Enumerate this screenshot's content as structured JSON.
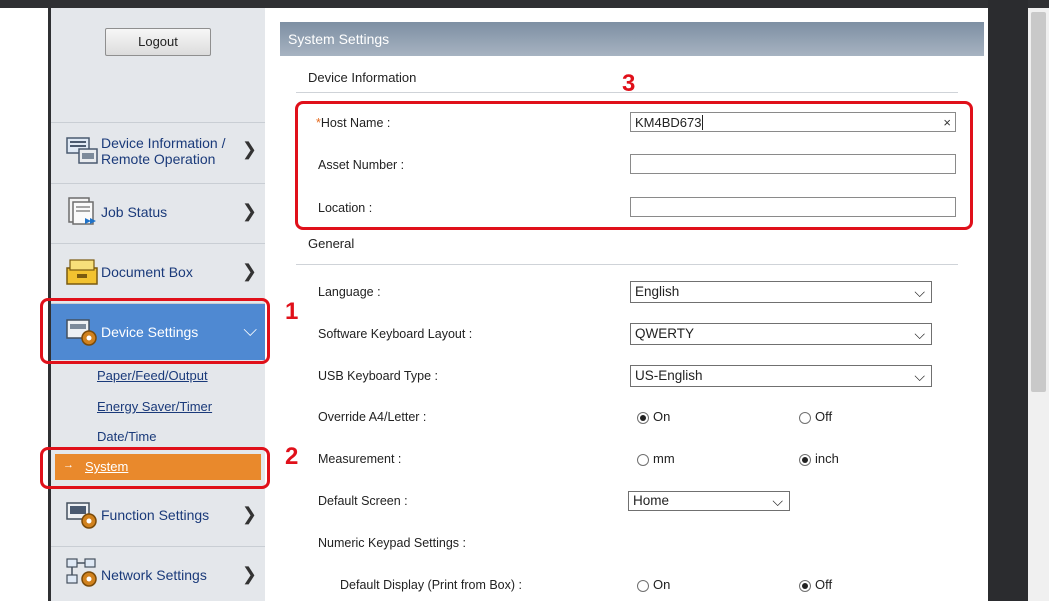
{
  "sidebar": {
    "logout_label": "Logout",
    "items": [
      {
        "label_line1": "Device Information /",
        "label_line2": "Remote Operation",
        "icon": "device-info-icon"
      },
      {
        "label": "Job Status",
        "icon": "job-status-icon"
      },
      {
        "label": "Document Box",
        "icon": "document-box-icon"
      },
      {
        "label": "Device Settings",
        "icon": "device-settings-icon",
        "active": true
      },
      {
        "label": "Function Settings",
        "icon": "function-settings-icon"
      },
      {
        "label": "Network Settings",
        "icon": "network-settings-icon"
      }
    ],
    "sublinks": [
      "Paper/Feed/Output",
      "Energy Saver/Timer",
      "Date/Time",
      "System"
    ],
    "active_color": "#4f89d2",
    "active_sub_color": "#e9892c"
  },
  "main": {
    "title": "System Settings",
    "device_info_title": "Device Information",
    "host_name_label": "Host Name :",
    "required_mark": "*",
    "host_name_value": "KM4BD673",
    "clear_symbol": "×",
    "asset_number_label": "Asset Number :",
    "asset_number_value": "",
    "location_label": "Location :",
    "location_value": "",
    "general_title": "General",
    "language_label": "Language :",
    "language_value": "English",
    "sw_keyboard_label": "Software Keyboard Layout :",
    "sw_keyboard_value": "QWERTY",
    "usb_keyboard_label": "USB Keyboard Type :",
    "usb_keyboard_value": "US-English",
    "override_label": "Override A4/Letter :",
    "override_on": "On",
    "override_off": "Off",
    "measurement_label": "Measurement :",
    "measurement_mm": "mm",
    "measurement_inch": "inch",
    "default_screen_label": "Default Screen :",
    "default_screen_value": "Home",
    "numeric_keypad_label": "Numeric Keypad Settings :",
    "default_display_label": "Default Display (Print from Box) :",
    "default_display_on": "On",
    "default_display_off": "Off",
    "caret_symbol": "⌵"
  },
  "annotations": {
    "step1": "1",
    "step2": "2",
    "step3": "3",
    "highlight_color": "#e0101a"
  }
}
